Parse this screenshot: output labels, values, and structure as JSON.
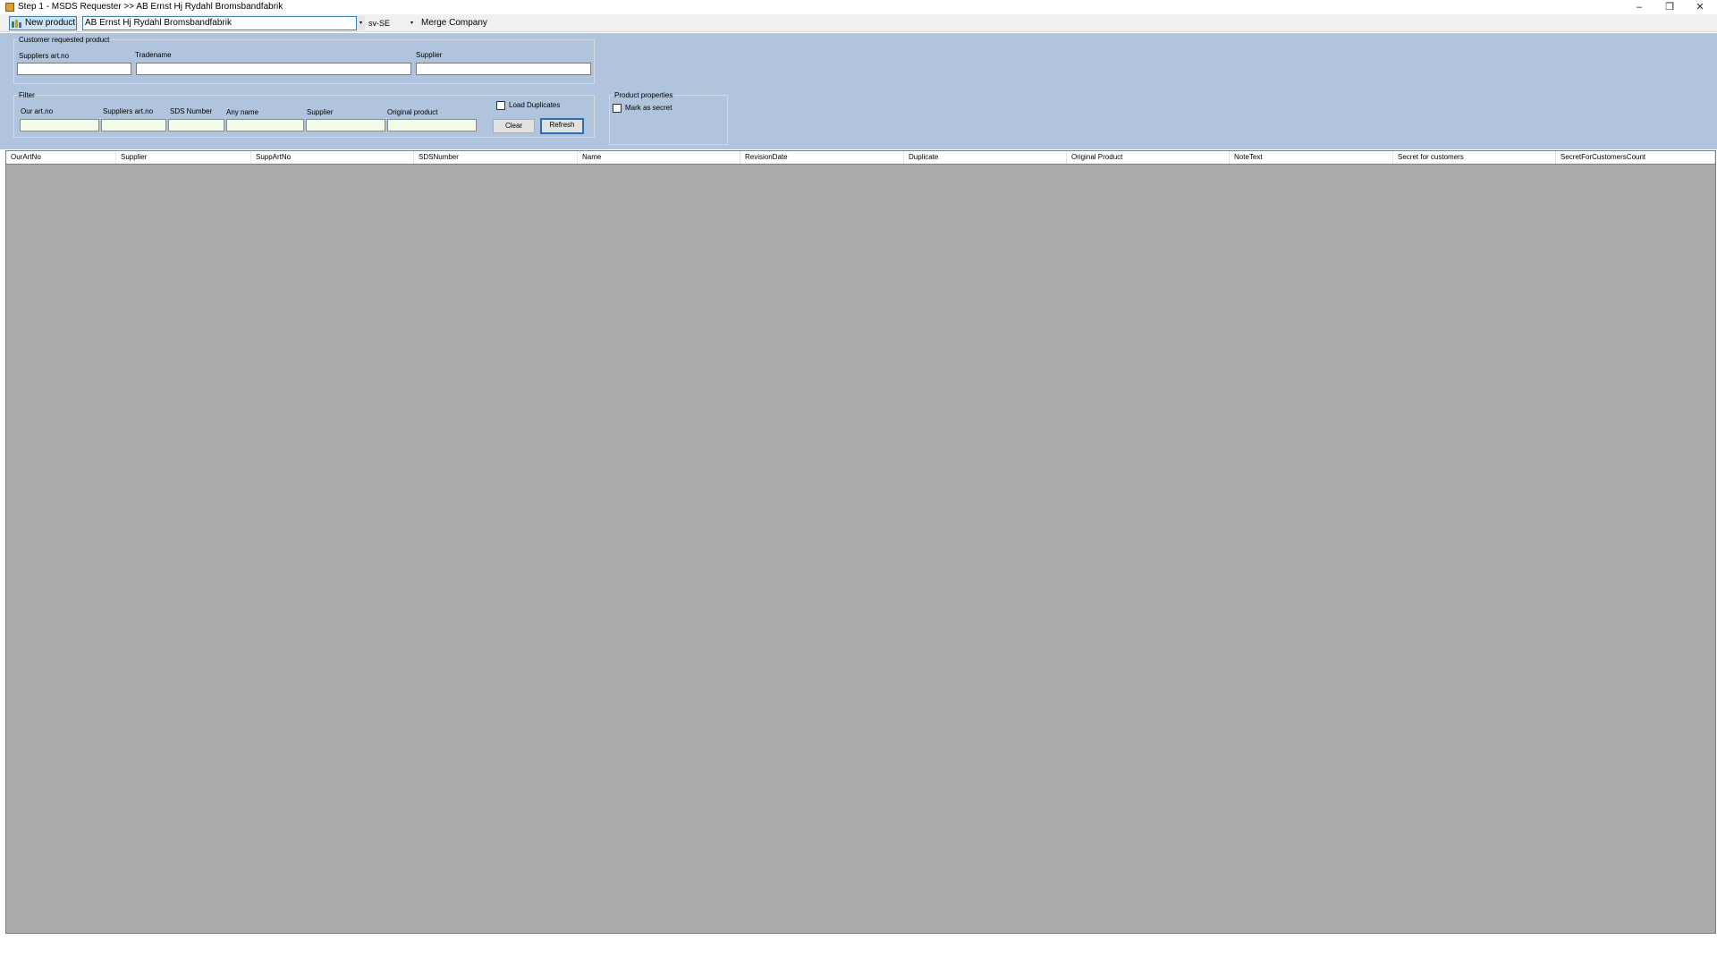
{
  "window": {
    "title": "Step 1 - MSDS Requester >> AB Ernst Hj Rydahl Bromsbandfabrik",
    "minimize": "–",
    "restore": "❐",
    "close": "✕",
    "icon": "app-icon"
  },
  "toolbar": {
    "new_product_label": "New product",
    "new_product_icon": "new-product-icon",
    "company_value": "AB Ernst Hj Rydahl Bromsbandfabrik",
    "language_value": "sv-SE",
    "merge_company_label": "Merge Company",
    "dropdown_glyph": "▾"
  },
  "customer_requested": {
    "title": "Customer requested product",
    "suppliers_art_no_label": "Suppliers art.no",
    "tradename_label": "Tradename",
    "supplier_label": "Supplier",
    "suppliers_art_no_value": "",
    "tradename_value": "",
    "supplier_value": ""
  },
  "filter": {
    "title": "Filter",
    "our_art_no_label": "Our art.no",
    "suppliers_art_no_label": "Suppliers art.no",
    "sds_number_label": "SDS Number",
    "any_name_label": "Any name",
    "supplier_label": "Supplier",
    "original_product_label": "Original product",
    "load_duplicates_label": "Load Duplicates",
    "load_duplicates_checked": false,
    "clear_label": "Clear",
    "refresh_label": "Refresh"
  },
  "product_properties": {
    "title": "Product properties",
    "mark_as_secret_label": "Mark as secret",
    "mark_as_secret_checked": false
  },
  "grid": {
    "columns": [
      "OurArtNo",
      "Supplier",
      "SuppArtNo",
      "SDSNumber",
      "Name",
      "RevisionDate",
      "Duplicate",
      "Original Product",
      "NoteText",
      "Secret for customers",
      "SecretForCustomersCount"
    ],
    "rows": []
  },
  "colors": {
    "panel_background": "#b0c4de",
    "grid_background": "#ababab",
    "accent": "#2a6fb8"
  }
}
